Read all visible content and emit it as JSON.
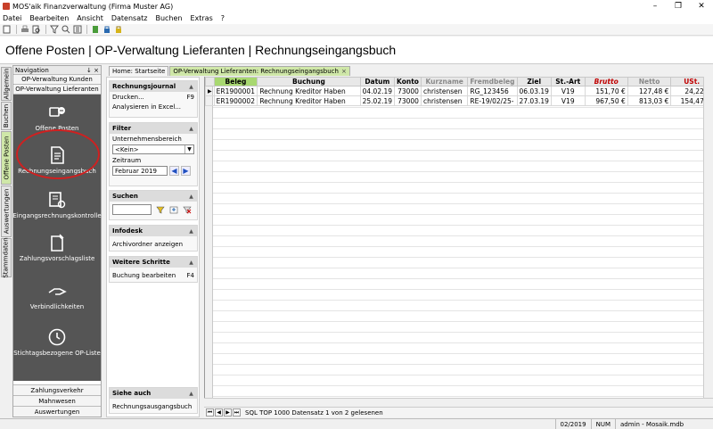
{
  "window": {
    "title": "MOS'aik Finanzverwaltung (Firma Muster AG)"
  },
  "menu": [
    "Datei",
    "Bearbeiten",
    "Ansicht",
    "Datensatz",
    "Buchen",
    "Extras",
    "?"
  ],
  "page_title": "Offene Posten | OP-Verwaltung Lieferanten | Rechnungseingangsbuch",
  "vtabs": [
    "Allgemein",
    "Buchen",
    "Offene Posten",
    "Auswertungen",
    "Stammdaten"
  ],
  "navigation": {
    "header": "Navigation",
    "pin": "↓ ×",
    "top_buttons": [
      "OP-Verwaltung Kunden",
      "OP-Verwaltung Lieferanten"
    ],
    "items": [
      {
        "label": "Offene Posten",
        "icon": "open-items-icon"
      },
      {
        "label": "Rechnungseingangsbuch",
        "icon": "invoice-book-icon"
      },
      {
        "label": "Eingangsrechnungskontrolle",
        "icon": "invoice-check-icon"
      },
      {
        "label": "Zahlungsvorschlagsliste",
        "icon": "payment-proposal-icon"
      },
      {
        "label": "Verbindlichkeiten",
        "icon": "liabilities-icon"
      },
      {
        "label": "Stichtagsbezogene OP-Liste",
        "icon": "clock-icon"
      }
    ],
    "bottom_buttons": [
      "Zahlungsverkehr",
      "Mahnwesen",
      "Auswertungen"
    ]
  },
  "doc_tabs": [
    {
      "label": "Home: Startseite"
    },
    {
      "label": "OP-Verwaltung Lieferanten: Rechnungseingangsbuch",
      "close": "×"
    }
  ],
  "tasks": {
    "journal": {
      "title": "Rechnungsjournal",
      "items": [
        {
          "label": "Drucken...",
          "key": "F9"
        },
        {
          "label": "Analysieren in Excel...",
          "key": ""
        }
      ]
    },
    "filter": {
      "title": "Filter",
      "company_label": "Unternehmensbereich",
      "company_value": "<Kein>",
      "period_label": "Zeitraum",
      "period_value": "Februar 2019"
    },
    "search": {
      "title": "Suchen"
    },
    "infodesk": {
      "title": "Infodesk",
      "items": [
        "Archivordner anzeigen"
      ]
    },
    "next": {
      "title": "Weitere Schritte",
      "items": [
        {
          "label": "Buchung bearbeiten",
          "key": "F4"
        }
      ]
    },
    "see_also": {
      "title": "Siehe auch",
      "items": [
        "Rechnungsausgangsbuch"
      ]
    }
  },
  "grid": {
    "columns": [
      "Beleg",
      "Buchung",
      "Datum",
      "Konto",
      "Kurzname",
      "Fremdbeleg",
      "Ziel",
      "St.-Art",
      "Brutto",
      "Netto",
      "USt."
    ],
    "rows": [
      [
        "ER1900001",
        "Rechnung Kreditor Haben",
        "04.02.19",
        "73000",
        "christensen",
        "RG_123456",
        "06.03.19",
        "V19",
        "151,70 €",
        "127,48 €",
        "24,22 €"
      ],
      [
        "ER1900002",
        "Rechnung Kreditor Haben",
        "25.02.19",
        "73000",
        "christensen",
        "RE-19/02/25-",
        "27.03.19",
        "V19",
        "967,50 €",
        "813,03 €",
        "154,47 €"
      ]
    ],
    "colors": {
      "brutto": "#c00000",
      "usst": "#c00000",
      "faded": "#888888",
      "beleg_header": "#a8d870"
    }
  },
  "nav_line": "SQL TOP 1000 Datensatz 1 von 2 gelesenen",
  "status": {
    "period": "02/2019",
    "num": "NUM",
    "user": "admin - Mosaik.mdb"
  }
}
